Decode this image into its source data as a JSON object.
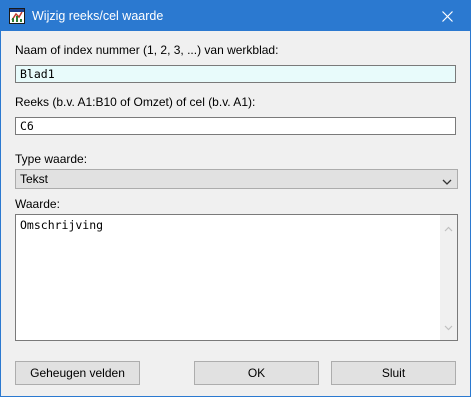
{
  "window": {
    "title": "Wijzig reeks/cel waarde",
    "icon": "spreadsheet-icon",
    "accent": "#2b79d0"
  },
  "fields": {
    "sheet_label": "Naam of index nummer (1, 2, 3, ...) van werkblad:",
    "sheet_value": "Blad1",
    "range_label": "Reeks (b.v. A1:B10 of Omzet) of cel (b.v. A1):",
    "range_value": "C6",
    "type_label": "Type waarde:",
    "type_value": "Tekst",
    "value_label": "Waarde:",
    "value_text": "Omschrijving"
  },
  "buttons": {
    "memory": "Geheugen velden",
    "ok": "OK",
    "close": "Sluit"
  }
}
